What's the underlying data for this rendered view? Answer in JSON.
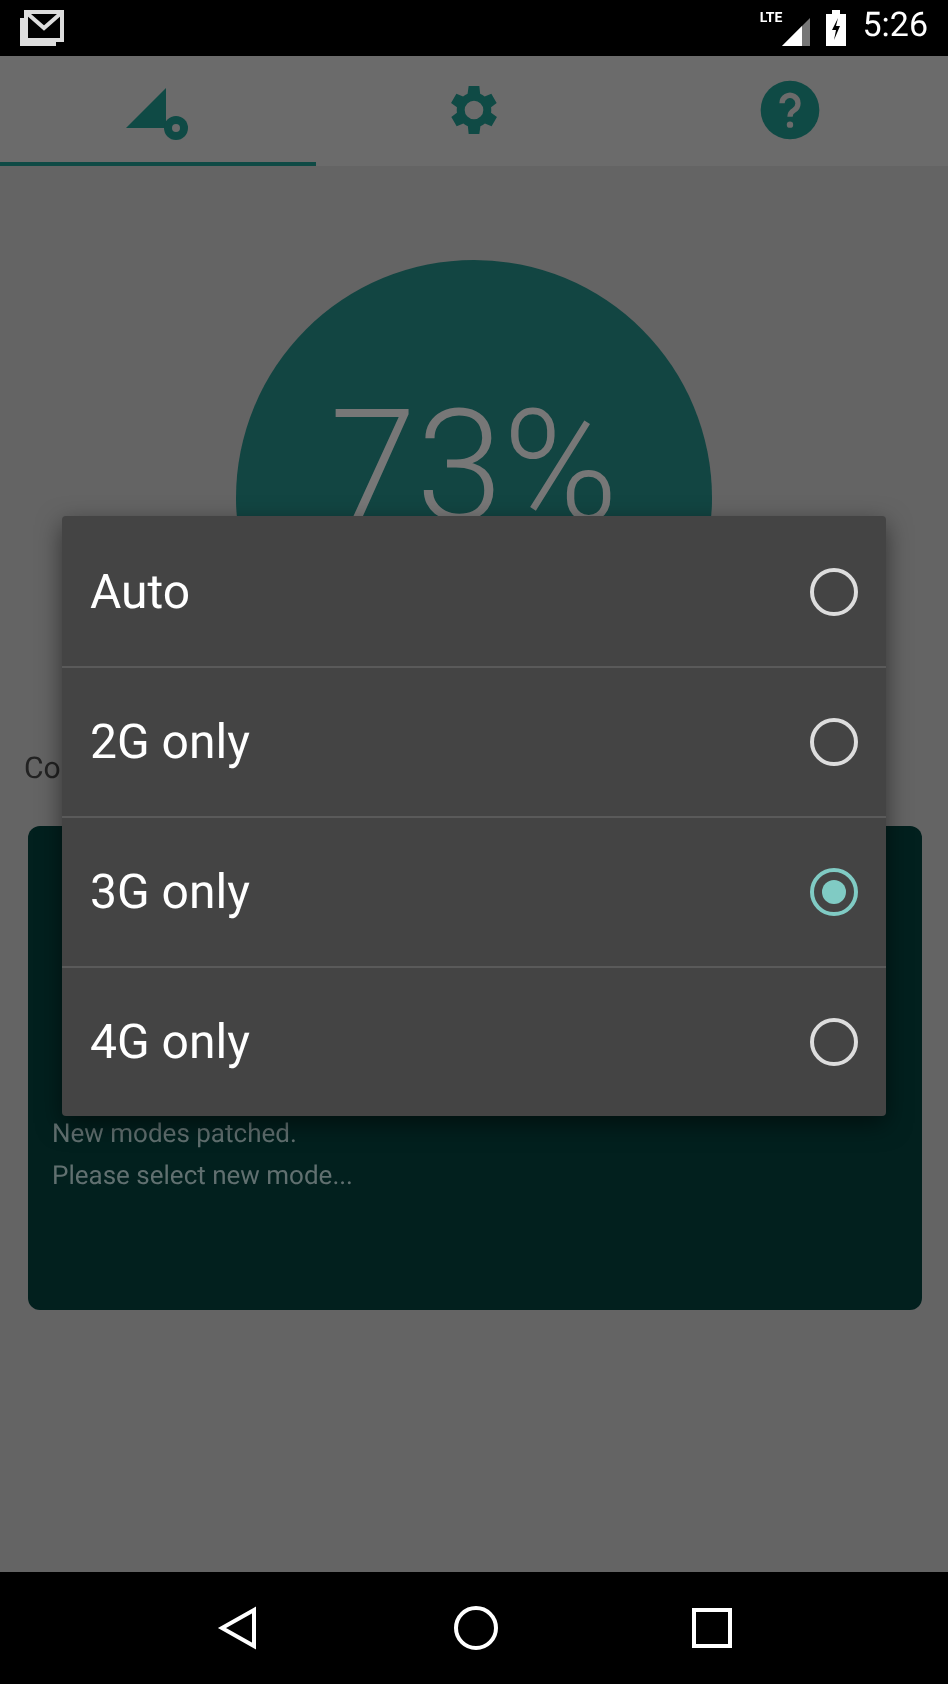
{
  "status_bar": {
    "network_label": "LTE",
    "time": "5:26"
  },
  "tabs": [
    {
      "selected": true
    },
    {
      "selected": false
    },
    {
      "selected": false
    }
  ],
  "gauge": {
    "reading": "73%"
  },
  "status_label": "Co",
  "log": {
    "lines": [
      "New modes patched.",
      "Please select new mode..."
    ]
  },
  "dialog": {
    "options": [
      {
        "label": "Auto",
        "selected": false
      },
      {
        "label": "2G only",
        "selected": false
      },
      {
        "label": "3G only",
        "selected": true
      },
      {
        "label": "4G only",
        "selected": false
      }
    ]
  }
}
